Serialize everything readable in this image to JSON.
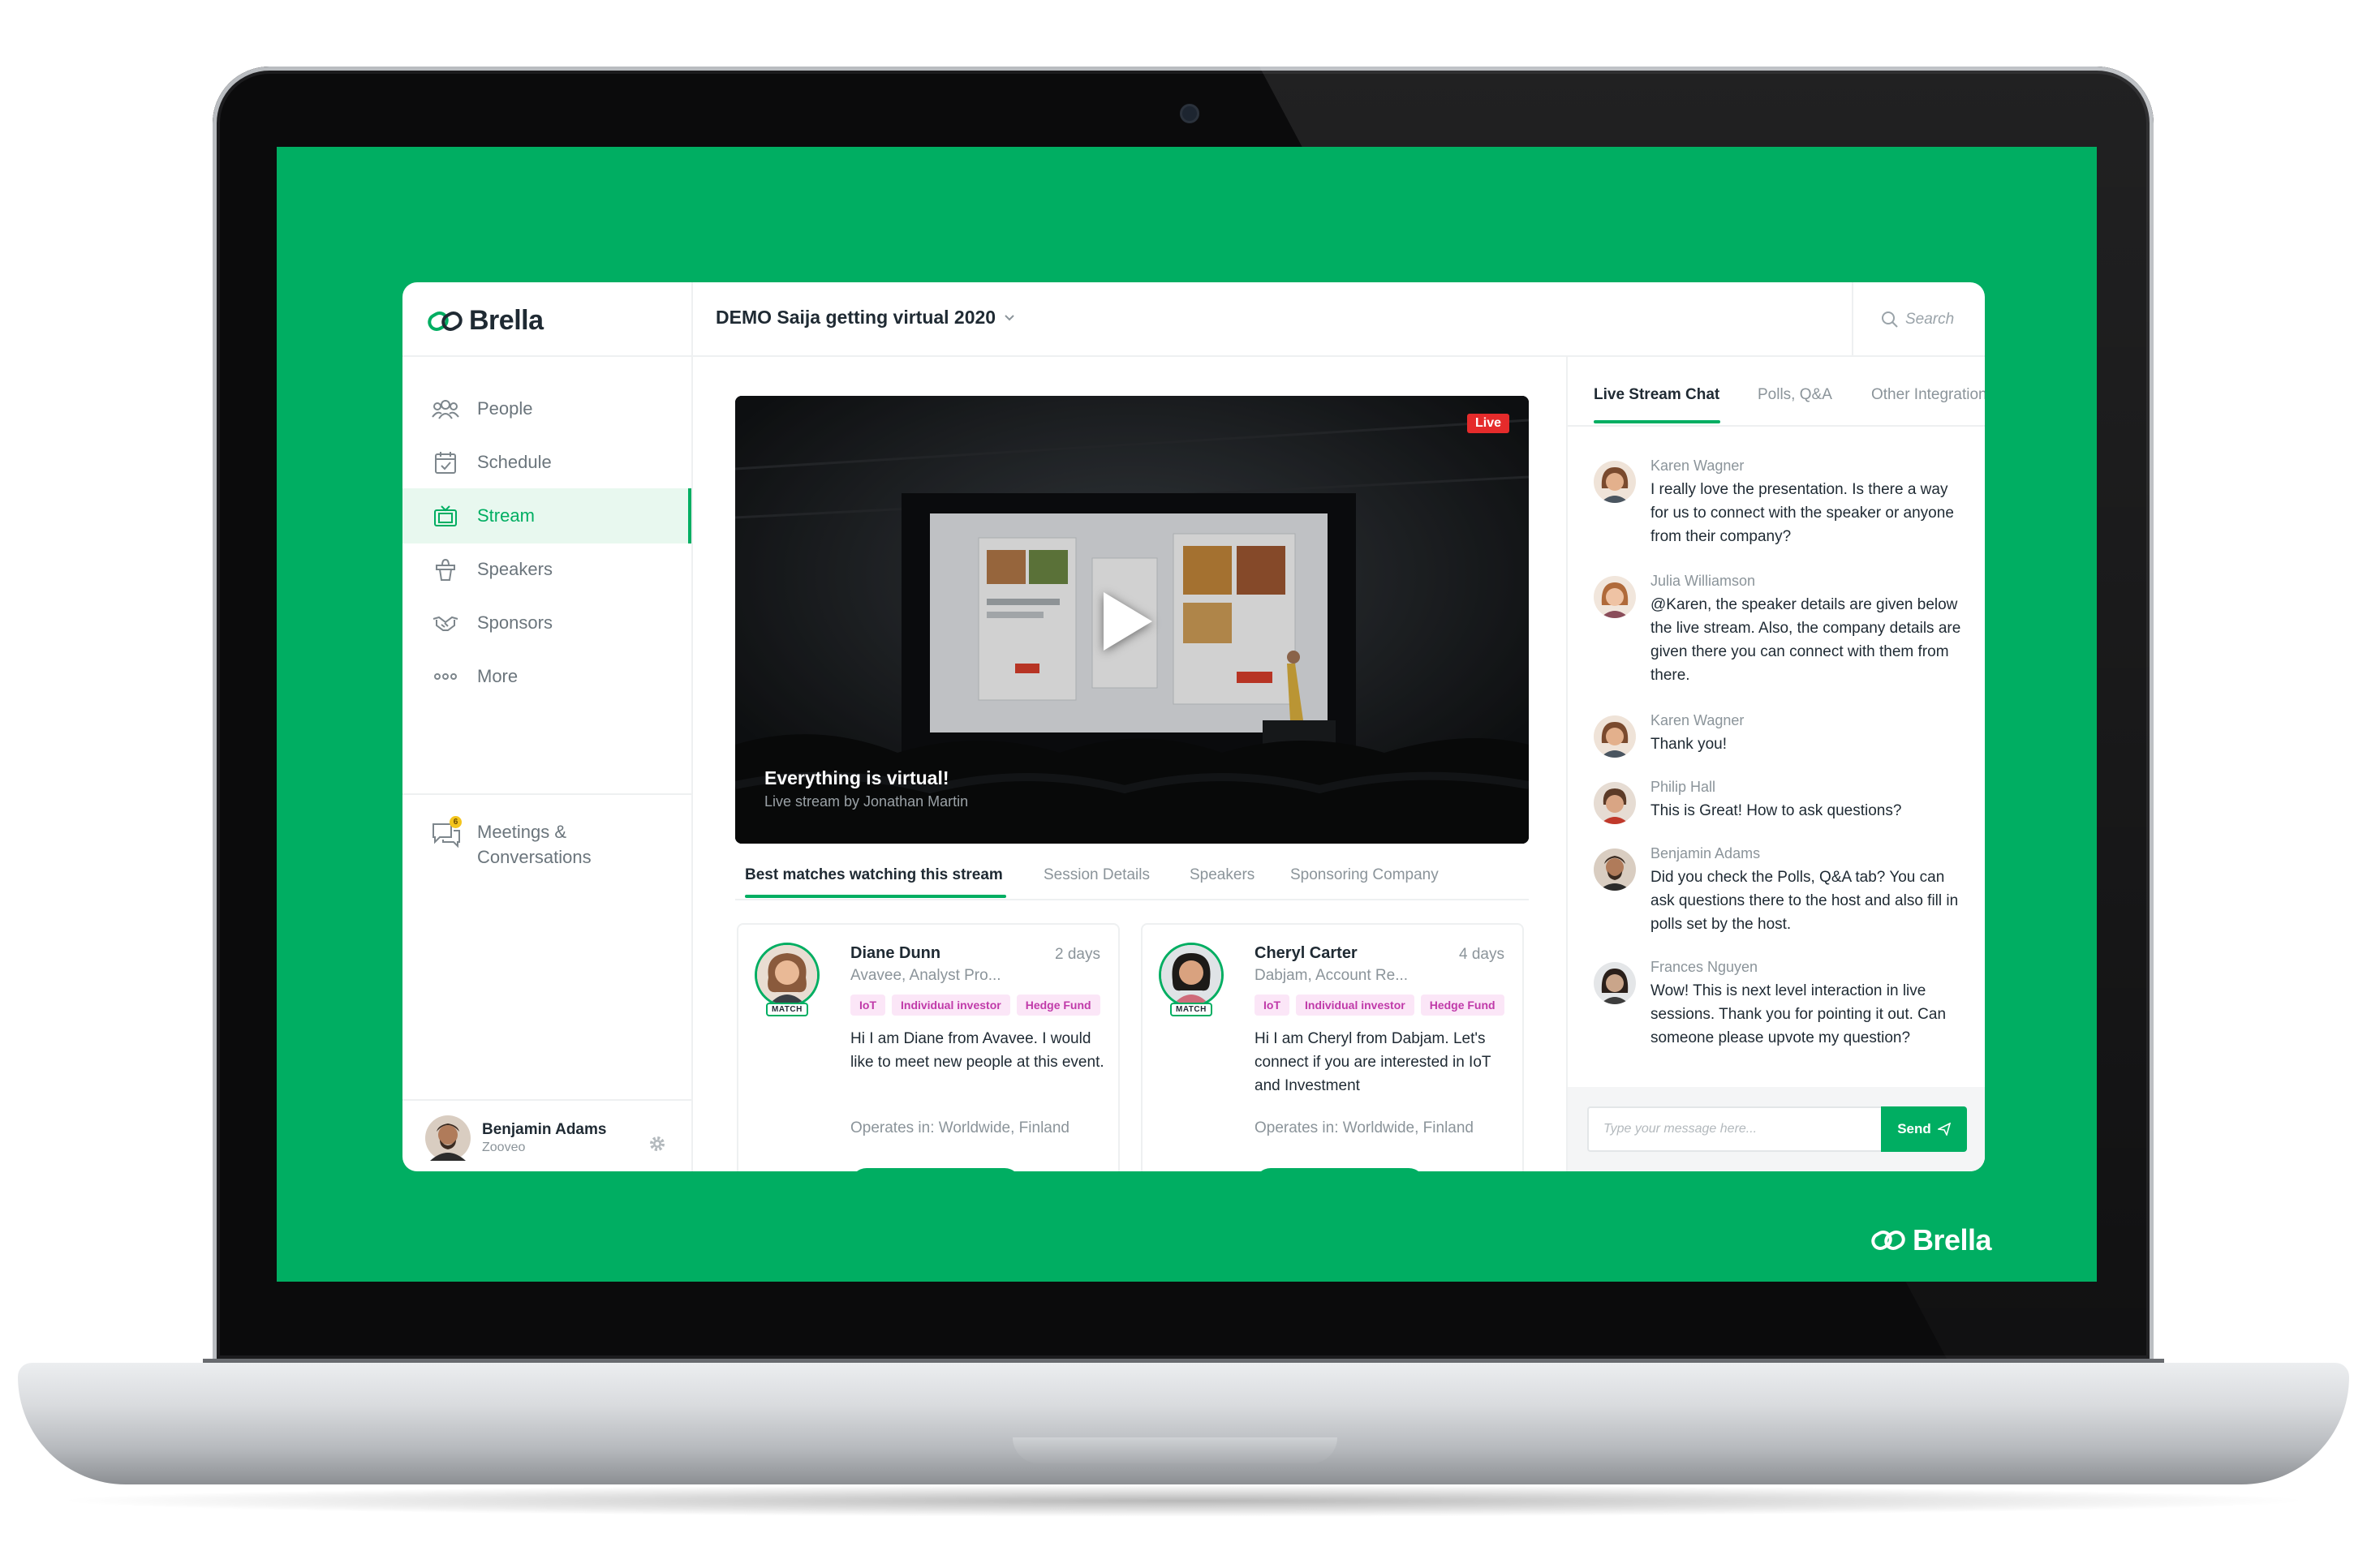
{
  "brand": {
    "name": "Brella"
  },
  "header": {
    "event_title": "DEMO Saija getting virtual 2020",
    "search_placeholder": "Search"
  },
  "sidebar": {
    "items": [
      {
        "label": "People",
        "icon": "people-icon",
        "active": false
      },
      {
        "label": "Schedule",
        "icon": "calendar-icon",
        "active": false
      },
      {
        "label": "Stream",
        "icon": "tv-icon",
        "active": true
      },
      {
        "label": "Speakers",
        "icon": "podium-icon",
        "active": false
      },
      {
        "label": "Sponsors",
        "icon": "handshake-icon",
        "active": false
      },
      {
        "label": "More",
        "icon": "more-icon",
        "active": false
      }
    ],
    "meetings": {
      "label_line1": "Meetings &",
      "label_line2": "Conversations",
      "badge": "6"
    },
    "user": {
      "name": "Benjamin Adams",
      "org": "Zooveo"
    }
  },
  "stream": {
    "live_label": "Live",
    "title": "Everything is virtual!",
    "subtitle": "Live stream by Jonathan Martin",
    "tabs": [
      "Best matches watching this stream",
      "Session Details",
      "Speakers",
      "Sponsoring Company"
    ],
    "active_tab": 0
  },
  "matches": [
    {
      "name": "Diane Dunn",
      "time": "2 days",
      "role": "Avavee, Analyst Pro...",
      "tags": [
        "IoT",
        "Individual investor",
        "Hedge Fund"
      ],
      "bio": "Hi I am Diane from Avavee. I would like to meet new people at this event.",
      "operates": "Operates in: Worldwide, Finland",
      "match_label": "MATCH"
    },
    {
      "name": "Cheryl Carter",
      "time": "4 days",
      "role": "Dabjam, Account Re...",
      "tags": [
        "IoT",
        "Individual investor",
        "Hedge Fund"
      ],
      "bio": "Hi I am Cheryl from Dabjam. Let's connect if you are interested in IoT and Investment",
      "operates": "Operates in: Worldwide, Finland",
      "match_label": "MATCH"
    }
  ],
  "chat": {
    "tabs": [
      "Live Stream Chat",
      "Polls, Q&A",
      "Other Integrations"
    ],
    "active_tab": 0,
    "messages": [
      {
        "author": "Karen Wagner",
        "text": "I really love the presentation. Is there a way for us to connect with the speaker or anyone from their company?"
      },
      {
        "author": "Julia Williamson",
        "text": "@Karen, the speaker details are given below the live stream. Also, the company details are given there you can connect with them from there."
      },
      {
        "author": "Karen Wagner",
        "text": "Thank you!"
      },
      {
        "author": "Philip Hall",
        "text": "This is Great! How to ask questions?"
      },
      {
        "author": "Benjamin Adams",
        "text": "Did you check the Polls, Q&A tab? You can ask questions there to the host and also fill in polls set by the host."
      },
      {
        "author": "Frances Nguyen",
        "text": "Wow! This is next level interaction in live sessions. Thank you for pointing it out. Can someone please upvote my question?"
      }
    ],
    "input_placeholder": "Type your message here...",
    "send_label": "Send"
  },
  "colors": {
    "brand_green": "#00ae62",
    "live_red": "#e52b2b",
    "tag_pink": "#c03aa9",
    "tag_bg": "#fbe6f7"
  }
}
